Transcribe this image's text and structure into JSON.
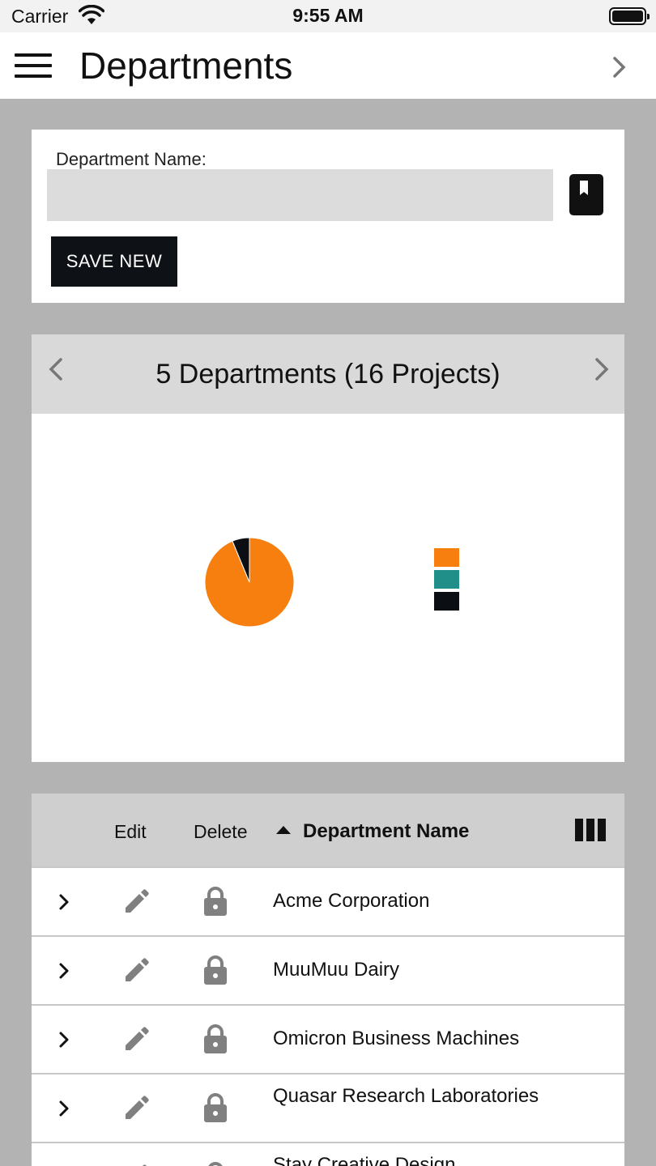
{
  "status_bar": {
    "carrier": "Carrier",
    "time": "9:55 AM"
  },
  "nav": {
    "title": "Departments"
  },
  "form": {
    "label": "Department Name:",
    "value": "",
    "save_label": "SAVE NEW"
  },
  "chart": {
    "title": "5 Departments (16 Projects)",
    "chart_data": {
      "type": "pie",
      "slices": [
        {
          "value": 15,
          "color": "#f77f0f"
        },
        {
          "value": 0,
          "color": "#208f8a"
        },
        {
          "value": 1,
          "color": "#0b0f14"
        }
      ],
      "legend_placement": "right"
    }
  },
  "table": {
    "columns": {
      "edit": "Edit",
      "delete": "Delete",
      "name": "Department Name"
    },
    "sort": "ascending",
    "rows": [
      {
        "name": "Acme Corporation"
      },
      {
        "name": "MuuMuu Dairy"
      },
      {
        "name": "Omicron Business Machines"
      },
      {
        "name": "Quasar Research Laboratories"
      },
      {
        "name": "Stay Creative Design"
      }
    ]
  },
  "colors": {
    "accent": "#f77f0f",
    "teal": "#208f8a",
    "dark": "#0b0f14",
    "background": "#b3b3b3"
  },
  "icons": {
    "menu": "hamburger-icon",
    "forward": "chevron-right-icon",
    "bookmark": "bookmark-icon",
    "edit": "pencil-icon",
    "delete": "lock-icon",
    "expand": "chevron-right-icon",
    "columns": "columns-icon",
    "sort": "sort-up-icon"
  }
}
